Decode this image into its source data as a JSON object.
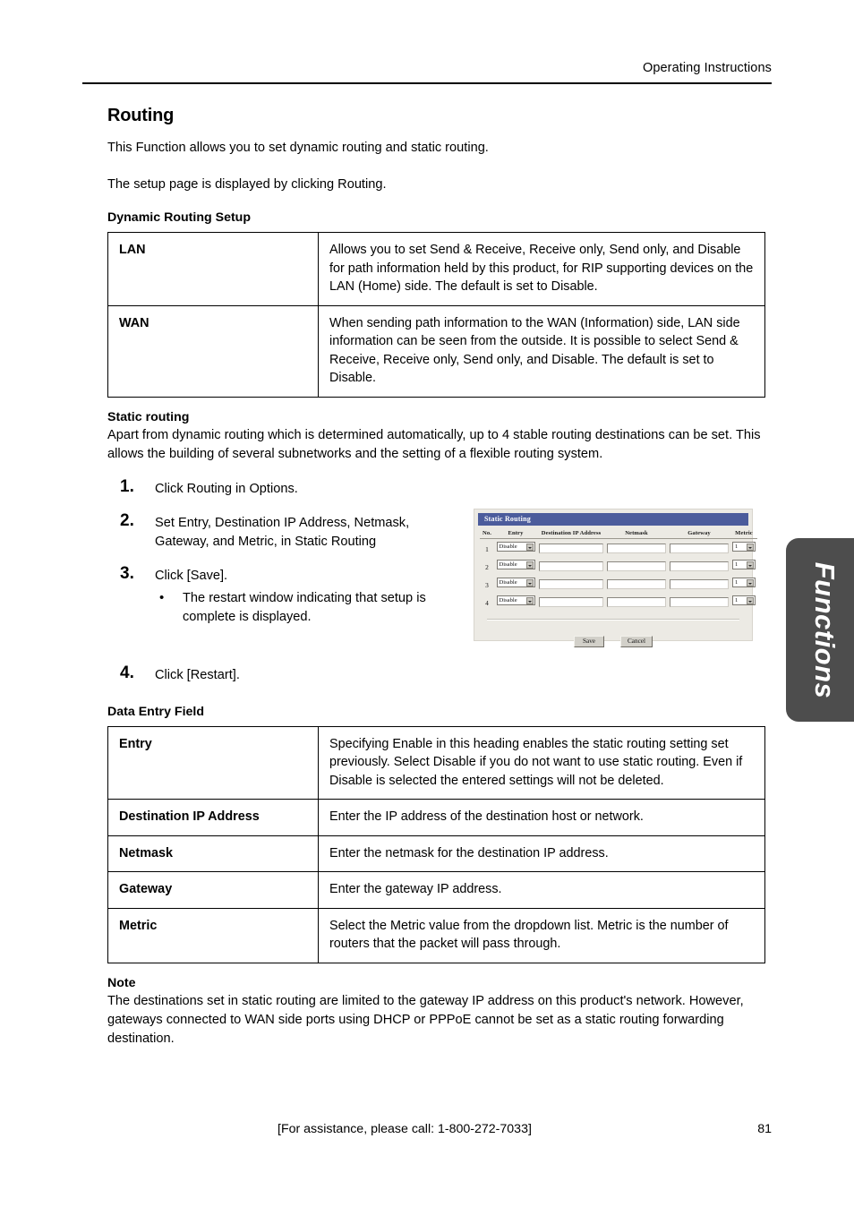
{
  "header": {
    "running_title": "Operating Instructions"
  },
  "page": {
    "title": "Routing",
    "intro_1": "This Function allows you to set dynamic routing and static routing.",
    "intro_2": "The setup page is displayed by clicking Routing."
  },
  "dynamic_routing": {
    "heading": "Dynamic Routing Setup",
    "rows": [
      {
        "term": "LAN",
        "description": "Allows you to set Send & Receive, Receive only, Send only, and Disable for path information held by this product, for RIP supporting devices on the LAN (Home) side. The default is set to Disable."
      },
      {
        "term": "WAN",
        "description": "When sending path information to the WAN (Information) side, LAN side information can be seen from the outside. It is possible to select Send & Receive, Receive only, Send only, and Disable. The default is set to Disable."
      }
    ]
  },
  "static_routing": {
    "heading": "Static routing",
    "intro": "Apart from dynamic routing which is determined automatically, up to 4 stable routing destinations can be set. This allows the building of several subnetworks and the setting of a flexible routing system.",
    "steps": [
      {
        "num": "1.",
        "text": "Click Routing in Options.",
        "bullets": []
      },
      {
        "num": "2.",
        "text": "Set Entry, Destination IP Address, Netmask, Gateway, and Metric, in Static Routing",
        "bullets": []
      },
      {
        "num": "3.",
        "text": "Click [Save].",
        "bullets": [
          "The restart window indicating that setup is complete is displayed."
        ]
      },
      {
        "num": "4.",
        "text": "Click [Restart].",
        "bullets": []
      }
    ]
  },
  "screenshot": {
    "window_title": "Static Routing",
    "columns": [
      "No.",
      "Entry",
      "Destination IP Address",
      "Netmask",
      "Gateway",
      "Metric"
    ],
    "rows": [
      {
        "no": "1",
        "entry": "Disable",
        "destination": "",
        "netmask": "",
        "gateway": "",
        "metric": "1"
      },
      {
        "no": "2",
        "entry": "Disable",
        "destination": "",
        "netmask": "",
        "gateway": "",
        "metric": "1"
      },
      {
        "no": "3",
        "entry": "Disable",
        "destination": "",
        "netmask": "",
        "gateway": "",
        "metric": "1"
      },
      {
        "no": "4",
        "entry": "Disable",
        "destination": "",
        "netmask": "",
        "gateway": "",
        "metric": "1"
      }
    ],
    "save_label": "Save",
    "cancel_label": "Cancel",
    "titlebar_color": "#4c5c9c"
  },
  "data_entry_field": {
    "heading": "Data Entry Field",
    "rows": [
      {
        "term": "Entry",
        "description": "Specifying Enable in this heading enables the static routing setting set previously. Select Disable if you do not want to use static routing. Even if Disable is selected the entered settings will not be deleted."
      },
      {
        "term": "Destination IP Address",
        "description": "Enter the IP address of the destination host or network."
      },
      {
        "term": "Netmask",
        "description": "Enter the netmask for the destination IP address."
      },
      {
        "term": "Gateway",
        "description": "Enter the gateway IP address."
      },
      {
        "term": "Metric",
        "description": "Select the Metric value from the dropdown list. Metric is the number of routers that the packet will pass through."
      }
    ]
  },
  "note": {
    "heading": "Note",
    "text": "The destinations set in static routing are limited to the gateway IP address on this product's network. However, gateways connected to WAN side ports using DHCP or PPPoE cannot be set as a static routing forwarding destination."
  },
  "side_tab": {
    "label": "Functions",
    "color": "#4d4d4d"
  },
  "footer": {
    "assistance": "[For assistance, please call: 1-800-272-7033]",
    "page_number": "81"
  }
}
